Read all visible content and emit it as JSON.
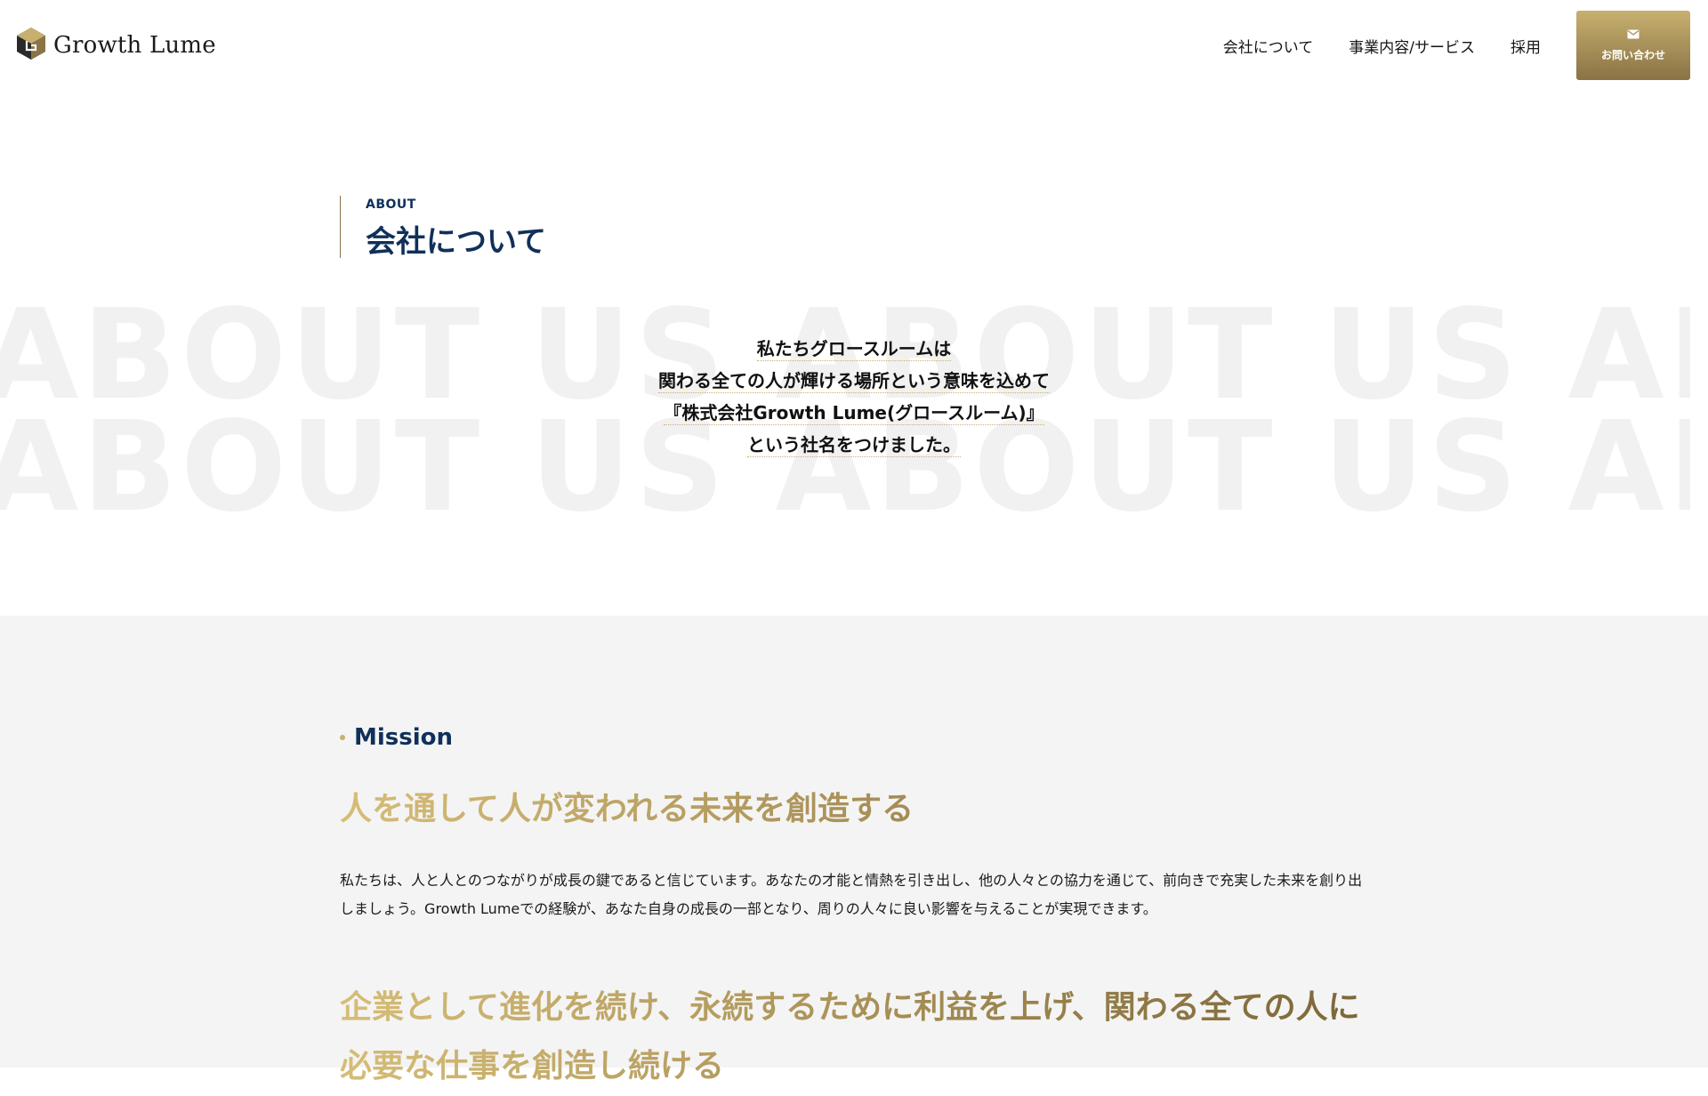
{
  "header": {
    "logo_text": "Growth Lume",
    "nav": [
      "会社について",
      "事業内容/サービス",
      "採用"
    ],
    "contact_label": "お問い合わせ"
  },
  "about": {
    "eyebrow": "ABOUT",
    "title": "会社について",
    "background_text": "ABOUT US  ABOUT US  ABOUT US",
    "statement": [
      "私たちグロースルームは",
      "関わる全ての人が輝ける場所という意味を込めて",
      "『株式会社Growth Lume(グロースルーム)』",
      "という社名をつけました。"
    ]
  },
  "mission": {
    "label": "Mission",
    "heading": "人を通して人が変われる未来を創造する",
    "body": "私たちは、人と人とのつながりが成長の鍵であると信じています。あなたの才能と情熱を引き出し、他の人々との協力を通じて、前向きで充実した未来を創り出しましょう。Growth Lumeでの経験が、あなた自身の成長の一部となり、周りの人々に良い影響を与えることが実現できます。",
    "heading2": "企業として進化を続け、永続するために利益を上げ、関わる全ての人に必要な仕事を創造し続ける"
  },
  "colors": {
    "navy": "#10305a",
    "gold_light": "#c7b06f",
    "gold_dark": "#8a7345",
    "gray_bg": "#f4f4f4"
  },
  "icons": [
    "logo-mark-icon",
    "mail-icon"
  ]
}
